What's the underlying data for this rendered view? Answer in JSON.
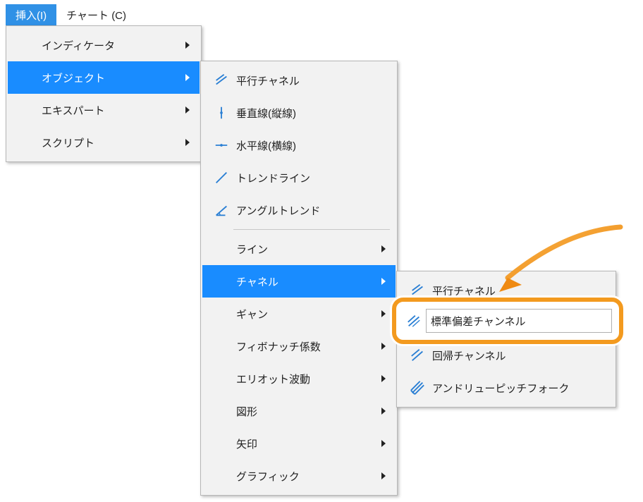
{
  "menubar": {
    "insert": "挿入(I)",
    "chart": "チャート (C)"
  },
  "menu1": {
    "indicator": "インディケータ",
    "object": "オブジェクト",
    "expert": "エキスパート",
    "script": "スクリプト"
  },
  "menu2": {
    "parallel_channel": "平行チャネル",
    "vertical_line": "垂直線(縦線)",
    "horizontal_line": "水平線(横線)",
    "trend_line": "トレンドライン",
    "angle_trend": "アングルトレンド",
    "line": "ライン",
    "channel": "チャネル",
    "gann": "ギャン",
    "fibonacci": "フィボナッチ係数",
    "elliott": "エリオット波動",
    "shapes": "図形",
    "arrows": "矢印",
    "graphics": "グラフィック"
  },
  "menu3": {
    "parallel_channel": "平行チャネル",
    "stddev_channel": "標準偏差チャンネル",
    "regression_channel": "回帰チャンネル",
    "andrews_pitchfork": "アンドリューピッチフォーク"
  },
  "colors": {
    "icon_blue": "#2a7fd4"
  }
}
